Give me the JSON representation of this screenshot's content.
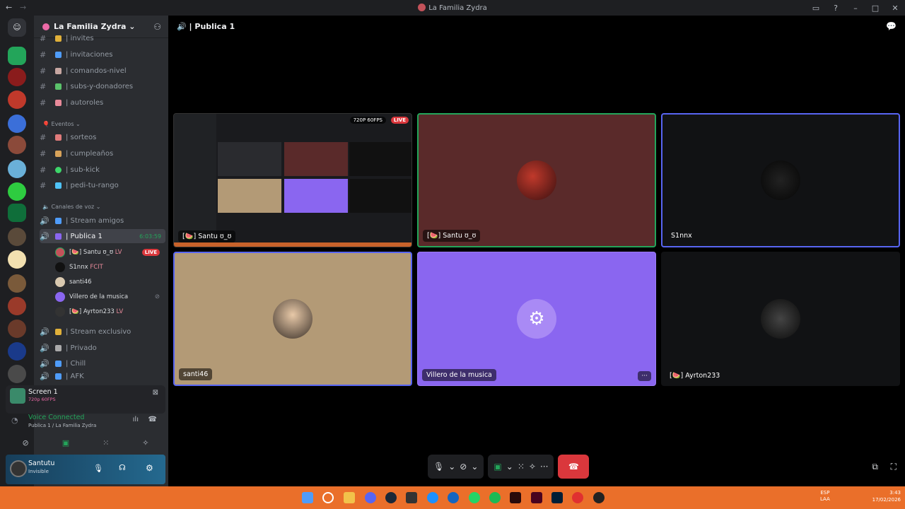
{
  "window": {
    "title": "La Familia Zydra"
  },
  "server": {
    "name": "La Familia Zydra"
  },
  "channels": {
    "text": [
      {
        "label": "| invites",
        "emoji": "#e0b03a"
      },
      {
        "label": "| invitaciones",
        "emoji": "#4f9cf9"
      },
      {
        "label": "| comandos-nivel",
        "emoji": "#c7a7a2"
      },
      {
        "label": "| subs-y-donadores",
        "emoji": "#5ac26a"
      },
      {
        "label": "| autoroles",
        "emoji": "#e88a9a"
      }
    ],
    "events_category": "Eventos",
    "events": [
      {
        "label": "| sorteos",
        "emoji": "#e07b7b"
      },
      {
        "label": "| cumpleaños",
        "emoji": "#d8a35a"
      },
      {
        "label": "| sub-kick",
        "emoji": "#3dd66a"
      },
      {
        "label": "| pedi-tu-rango",
        "emoji": "#4fc3f7"
      }
    ],
    "voice_category": "Canales de voz",
    "voice": [
      {
        "label": "| Stream amigos"
      },
      {
        "label": "| Publica 1",
        "time": "6:03:59"
      },
      {
        "label": "| Stream exclusivo"
      },
      {
        "label": "| Privado"
      },
      {
        "label": "| Chill"
      },
      {
        "label": "| AFK"
      }
    ],
    "voice_users": [
      {
        "name": "[🍉] Santu ʊ_ʊ",
        "status": "LV",
        "live": "LIVE"
      },
      {
        "name": "S1nnx",
        "status": "FCIT"
      },
      {
        "name": "santi46"
      },
      {
        "name": "Villero de la musica"
      },
      {
        "name": "[🍉] Ayrton233",
        "status": "LV"
      }
    ]
  },
  "screen": {
    "title": "Screen 1",
    "sub": "720p 60FPS"
  },
  "voice_connected": {
    "title": "Voice Connected",
    "sub": "Publica 1 / La Familia Zydra"
  },
  "user": {
    "name": "Santutu",
    "status": "Invisible"
  },
  "main": {
    "channel": "| Publica 1",
    "stream_badge": "720P 60FPS",
    "stream_live": "LIVE",
    "tiles": [
      {
        "name": "[🍉] Santu ʊ_ʊ"
      },
      {
        "name": "[🍉] Santu ʊ_ʊ"
      },
      {
        "name": "S1nnx"
      },
      {
        "name": "santi46"
      },
      {
        "name": "Villero de la musica"
      },
      {
        "name": "[🍉] Ayrton233"
      }
    ]
  },
  "taskbar": {
    "lang1": "ESP",
    "lang2": "LAA",
    "time": "3:43",
    "date": "17/02/2026"
  },
  "colors": {
    "accent": "#5865f2",
    "live": "#da373c",
    "speaking": "#23a55a",
    "tile_purple": "#8a66f0",
    "tile_tan": "#b39a76",
    "tile_red": "#5a2a2a"
  }
}
